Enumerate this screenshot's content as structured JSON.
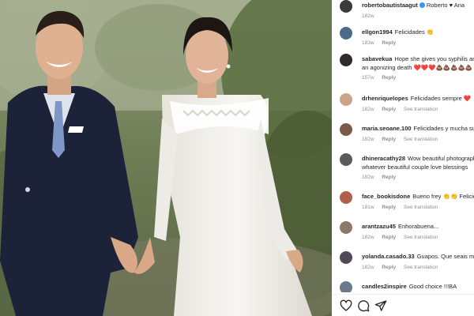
{
  "post": {
    "photo": "wedding couple walking hand in hand",
    "colors": {
      "suit": "#1c2238",
      "dress": "#f3f1ec",
      "foliage": "#6f7f57"
    }
  },
  "comments": [
    {
      "username": "robertobautistaagut",
      "verified": true,
      "text": "Roberto ♥ Ana",
      "time": "182w",
      "reply": "",
      "translation": "",
      "avatar_color": "#3a3a3a"
    },
    {
      "username": "ellgon1994",
      "verified": false,
      "text": "Felicidades 👏",
      "time": "183w",
      "reply": "Reply",
      "translation": "",
      "avatar_color": "#4a6b8a"
    },
    {
      "username": "sabavekua",
      "verified": false,
      "text": "Hope she gives you syphilis and an agonizing death ❤️❤️❤️💩💩💩💩💩",
      "time": "157w",
      "reply": "Reply",
      "translation": "",
      "avatar_color": "#2e2a2a"
    },
    {
      "username": "drhenriquelopes",
      "verified": false,
      "text": "Felicidades sempre ❤️",
      "time": "182w",
      "reply": "Reply",
      "translation": "See translation",
      "avatar_color": "#c9a48a"
    },
    {
      "username": "maria.seoane.100",
      "verified": false,
      "text": "Felicidades y mucha suerte",
      "time": "182w",
      "reply": "Reply",
      "translation": "See translation",
      "avatar_color": "#7a5a4a"
    },
    {
      "username": "dhineracathy28",
      "verified": false,
      "text": "Wow beautiful photograph, whatever beautiful couple love blessings",
      "time": "182w",
      "reply": "Reply",
      "translation": "",
      "avatar_color": "#5a5a5a"
    },
    {
      "username": "face_bookisdone",
      "verified": false,
      "text": "Bueno frey 👏👏 Felicidades",
      "time": "181w",
      "reply": "Reply",
      "translation": "See translation",
      "avatar_color": "#b0604a"
    },
    {
      "username": "arantzazu45",
      "verified": false,
      "text": "Enhorabuena...",
      "time": "182w",
      "reply": "Reply",
      "translation": "See translation",
      "avatar_color": "#8a7a6a"
    },
    {
      "username": "yolanda.casado.33",
      "verified": false,
      "text": "Guapos. Que seais muy felices",
      "time": "182w",
      "reply": "Reply",
      "translation": "See translation",
      "avatar_color": "#4f4a55"
    },
    {
      "username": "candles2inspire",
      "verified": false,
      "text": "Good choice !!!BA",
      "time": "",
      "reply": "",
      "translation": "",
      "avatar_color": "#6a7a8a"
    }
  ],
  "actions": [
    {
      "name": "like-icon",
      "label": "Like"
    },
    {
      "name": "comment-icon",
      "label": "Comment"
    },
    {
      "name": "share-icon",
      "label": "Share"
    }
  ]
}
